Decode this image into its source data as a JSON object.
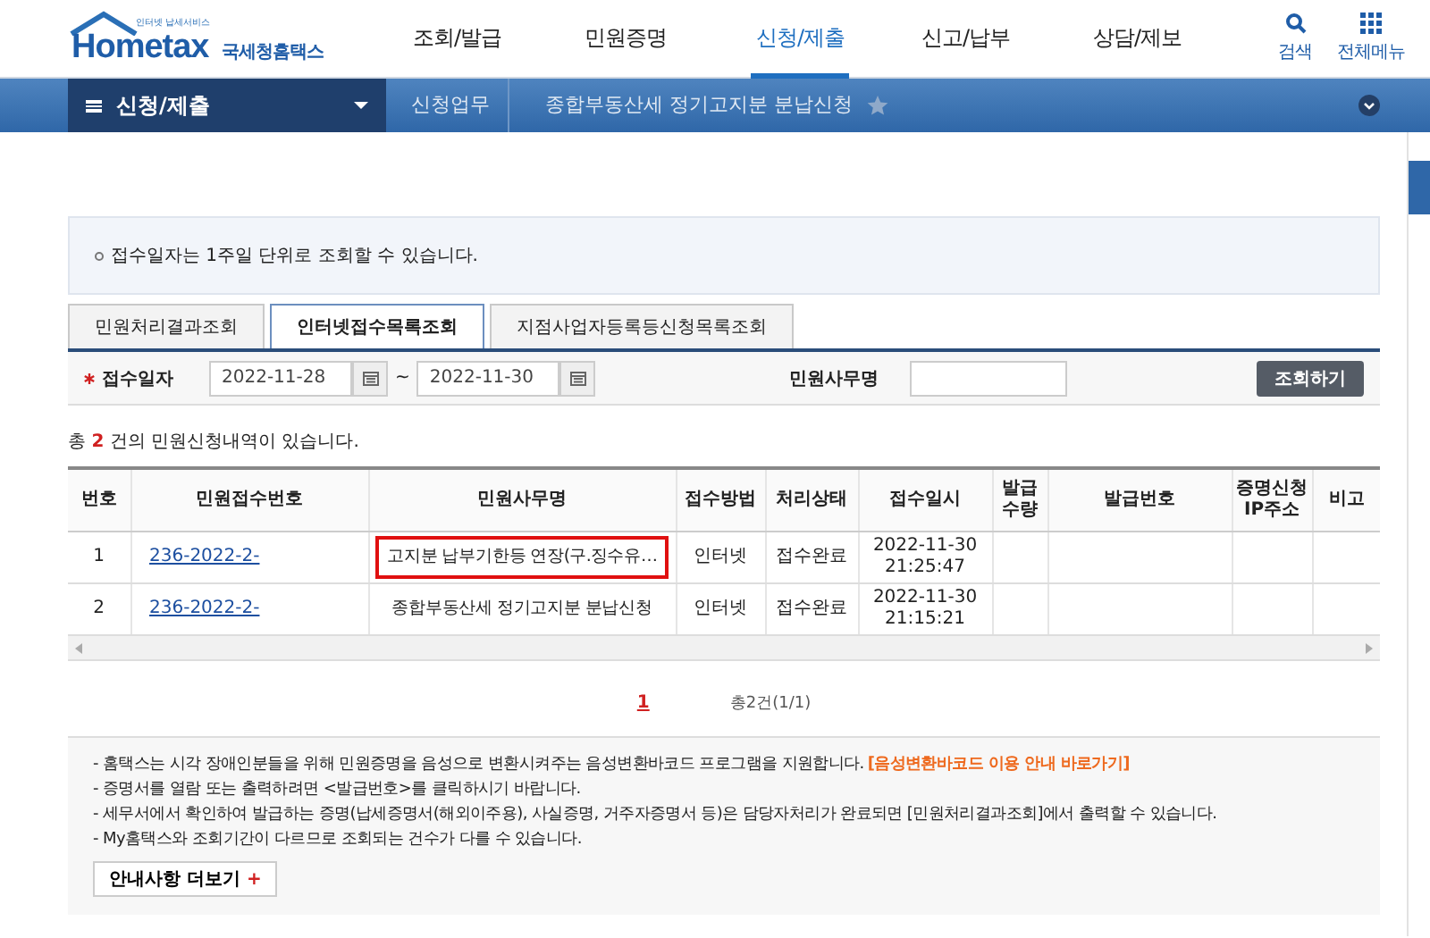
{
  "logo": {
    "tagline": "인터넷 납세서비스",
    "main": "Hometax",
    "sub": "국세청홈택스"
  },
  "top_menu": [
    {
      "label": "조회/발급",
      "selected": false
    },
    {
      "label": "민원증명",
      "selected": false
    },
    {
      "label": "신청/제출",
      "selected": true
    },
    {
      "label": "신고/납부",
      "selected": false
    },
    {
      "label": "상담/제보",
      "selected": false
    }
  ],
  "utility": [
    {
      "kind": "search",
      "label": "검색"
    },
    {
      "kind": "grid",
      "label": "전체메뉴"
    }
  ],
  "breadcrumb": {
    "menu": "신청/제출",
    "items": [
      "신청업무",
      "종합부동산세 정기고지분 분납신청"
    ]
  },
  "notice": "접수일자는 1주일 단위로 조회할 수 있습니다.",
  "tabs": [
    {
      "label": "민원처리결과조회",
      "selected": false
    },
    {
      "label": "인터넷접수목록조회",
      "selected": true
    },
    {
      "label": "지점사업자등록등신청목록조회",
      "selected": false
    }
  ],
  "search": {
    "date_label": "접수일자",
    "date_from": "2022-11-28",
    "separator": "~",
    "date_to": "2022-11-30",
    "name_label": "민원사무명",
    "button": "조회하기"
  },
  "total": {
    "before": "총",
    "count": "2",
    "after": "건의 민원신청내역이 있습니다."
  },
  "table": {
    "columns": [
      "번호",
      "민원접수번호",
      "민원사무명",
      "접수방법",
      "처리상태",
      "접수일시",
      "발급\n수량",
      "발급번호",
      "증명신청\nIP주소",
      "비고"
    ],
    "rows": [
      {
        "no": "1",
        "receipt": "236-2022-2-",
        "name": "고지분 납부기한등 연장(구.징수유…",
        "highlighted": true,
        "method": "인터넷",
        "status": "접수완료",
        "date": "2022-11-30",
        "time": "21:25:47"
      },
      {
        "no": "2",
        "receipt": "236-2022-2-",
        "name": "종합부동산세 정기고지분 분납신청",
        "highlighted": false,
        "method": "인터넷",
        "status": "접수완료",
        "date": "2022-11-30",
        "time": "21:15:21"
      }
    ]
  },
  "pagination": {
    "pages": [
      {
        "label": "1",
        "selected": true
      }
    ],
    "summary": "총2건(1/1)"
  },
  "info": {
    "lines": [
      {
        "text": "- 홈택스는 시각 장애인분들을 위해 민원증명을 음성으로 변환시켜주는 음성변환바코드 프로그램을 지원합니다.",
        "link": "[음성변환바코드 이용 안내 바로가기]"
      },
      {
        "text": "- 증명서를 열람 또는 출력하려면 <발급번호>를 클릭하시기 바랍니다."
      },
      {
        "text": "- 세무서에서 확인하여 발급하는 증명(납세증명서(해외이주용), 사실증명, 거주자증명서 등)은 담당자처리가 완료되면 [민원처리결과조회]에서 출력할 수 있습니다."
      },
      {
        "text": "- My홈택스와 조회기간이 다르므로 조회되는 건수가 다를 수 있습니다."
      }
    ],
    "more_button": "안내사항 더보기",
    "more_icon": "+"
  }
}
